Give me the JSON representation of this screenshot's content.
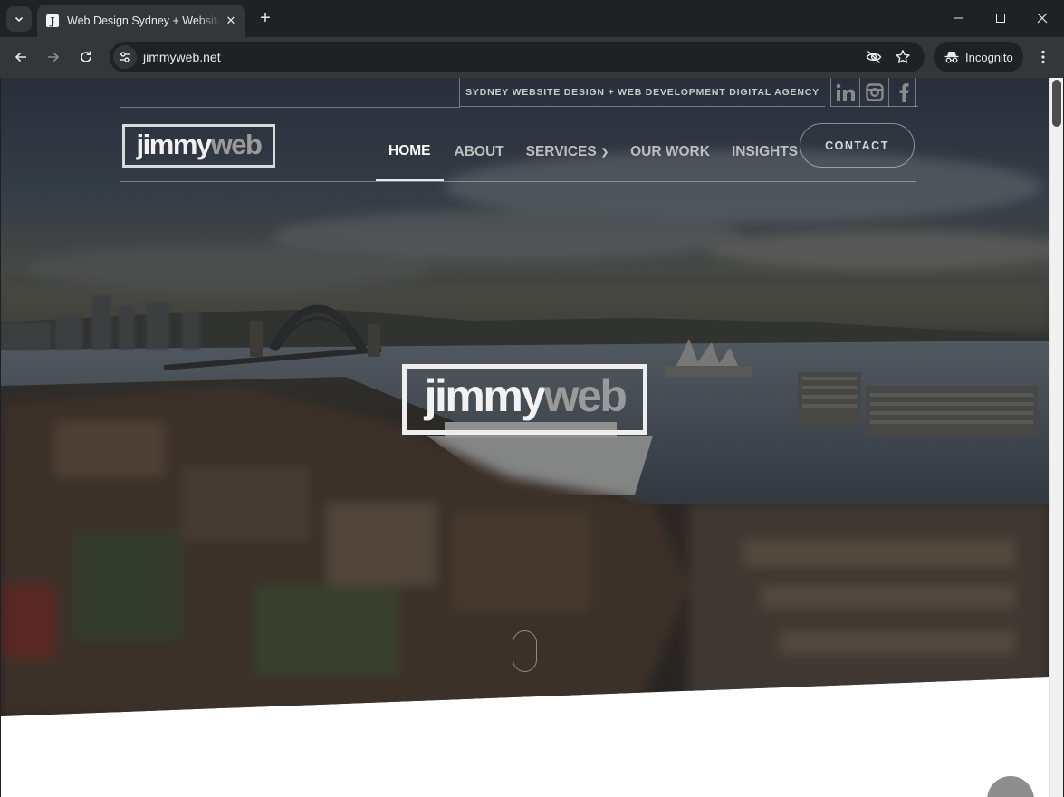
{
  "browser": {
    "tab_title": "Web Design Sydney + Website Design",
    "favicon_letter": "J",
    "url": "jimmyweb.net",
    "profile_label": "Incognito"
  },
  "site": {
    "tagline": "SYDNEY WEBSITE DESIGN + WEB DEVELOPMENT DIGITAL AGENCY",
    "social": [
      "linkedin-icon",
      "instagram-icon",
      "facebook-icon"
    ],
    "logo": {
      "part1": "jimmy",
      "part2": "web"
    },
    "nav": [
      {
        "label": "HOME",
        "active": true
      },
      {
        "label": "ABOUT"
      },
      {
        "label": "SERVICES",
        "has_dropdown": true
      },
      {
        "label": "OUR WORK"
      },
      {
        "label": "INSIGHTS"
      }
    ],
    "contact_label": "CONTACT",
    "colors": {
      "nav_active": "#ffffff",
      "nav_inactive": "#bdbdbd",
      "logo_secondary": "#9a9a9a"
    }
  }
}
